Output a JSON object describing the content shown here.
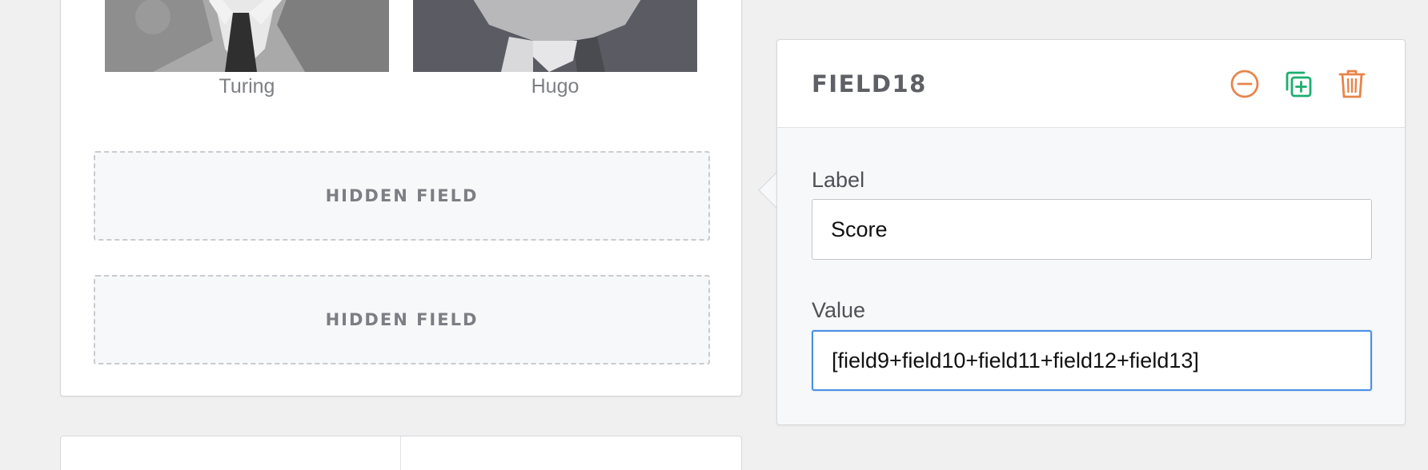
{
  "preview": {
    "photos": [
      {
        "caption": "Turing"
      },
      {
        "caption": "Hugo"
      }
    ],
    "hidden_fields": [
      {
        "label": "HIDDEN FIELD"
      },
      {
        "label": "HIDDEN FIELD"
      }
    ]
  },
  "settings_panel": {
    "title": "FIELD18",
    "icons": {
      "collapse": "minus-circle-icon",
      "duplicate": "duplicate-icon",
      "delete": "trash-icon"
    },
    "label_field": {
      "label": "Label",
      "value": "Score"
    },
    "value_field": {
      "label": "Value",
      "value": "[field9+field10+field11+field12+field13]"
    }
  },
  "colors": {
    "collapse_icon": "#e8844a",
    "duplicate_icon": "#1dae6f",
    "delete_icon": "#e8844a",
    "focus_border": "#4a90e2"
  }
}
